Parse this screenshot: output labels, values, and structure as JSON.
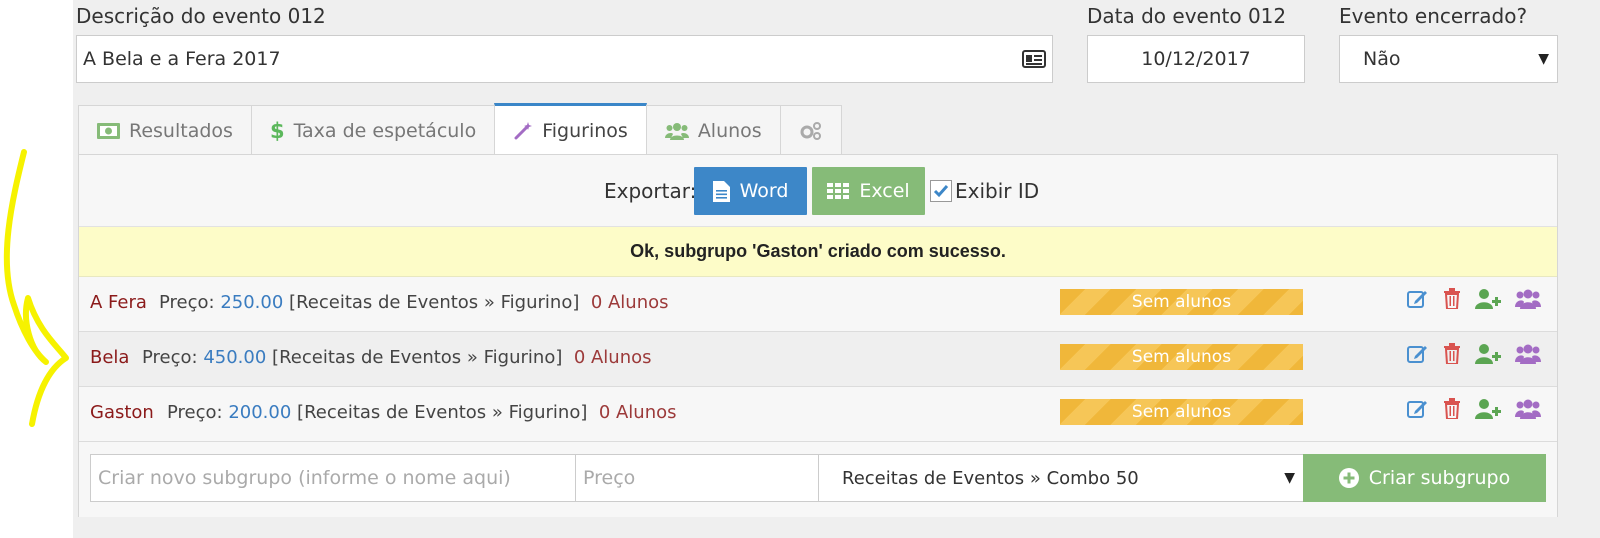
{
  "form": {
    "description_label": "Descrição do evento 012",
    "description_value": "A Bela e a Fera 2017",
    "date_label": "Data do evento 012",
    "date_value": "10/12/2017",
    "closed_label": "Evento encerrado?",
    "closed_value": "Não"
  },
  "tabs": [
    {
      "label": "Resultados",
      "icon": "money-icon"
    },
    {
      "label": "Taxa de espetáculo",
      "icon": "dollar-icon"
    },
    {
      "label": "Figurinos",
      "icon": "magic-wand-icon",
      "active": true
    },
    {
      "label": "Alunos",
      "icon": "users-icon"
    },
    {
      "label": "",
      "icon": "gears-icon"
    }
  ],
  "export": {
    "label": "Exportar:",
    "word_label": "Word",
    "excel_label": "Excel",
    "show_id_label": "Exibir ID",
    "show_id_checked": true
  },
  "alert": {
    "message": "Ok, subgrupo 'Gaston' criado com sucesso."
  },
  "subgroups": [
    {
      "name": "A Fera",
      "price_label": "Preço:",
      "price": "250.00",
      "category": "[Receitas de Eventos » Figurino]",
      "students": "0 Alunos",
      "status": "Sem alunos"
    },
    {
      "name": "Bela",
      "price_label": "Preço:",
      "price": "450.00",
      "category": "[Receitas de Eventos » Figurino]",
      "students": "0 Alunos",
      "status": "Sem alunos"
    },
    {
      "name": "Gaston",
      "price_label": "Preço:",
      "price": "200.00",
      "category": "[Receitas de Eventos » Figurino]",
      "students": "0 Alunos",
      "status": "Sem alunos"
    }
  ],
  "create": {
    "name_placeholder": "Criar novo subgrupo (informe o nome aqui)",
    "price_placeholder": "Preço",
    "category_value": "Receitas de Eventos » Combo 50",
    "button_label": "Criar subgrupo"
  },
  "colors": {
    "primary": "#3d87c8",
    "success": "#86bb78",
    "warning": "#f0b73a",
    "danger": "#d9534f",
    "purple": "#a36cc4",
    "name_red": "#8b1a1a"
  }
}
